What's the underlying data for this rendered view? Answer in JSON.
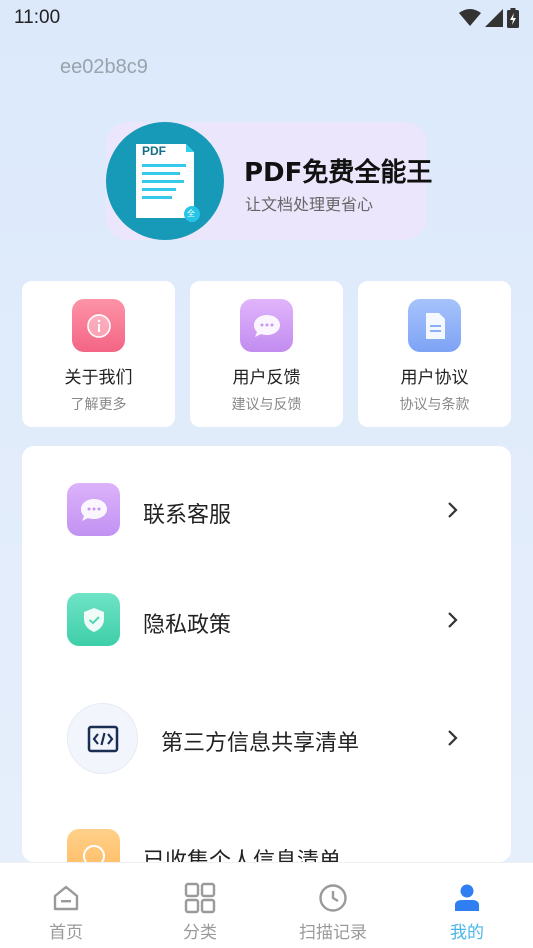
{
  "status_bar": {
    "time": "11:00"
  },
  "user": {
    "id": "ee02b8c9"
  },
  "app": {
    "name": "PDF免费全能王",
    "slogan": "让文档处理更省心",
    "logo_text": "PDF",
    "logo_badge": "全"
  },
  "quick_links": [
    {
      "title": "关于我们",
      "subtitle": "了解更多",
      "icon": "info-icon",
      "color": "#f7768f"
    },
    {
      "title": "用户反馈",
      "subtitle": "建议与反馈",
      "icon": "chat-bubble-icon",
      "color": "#cf98f3"
    },
    {
      "title": "用户协议",
      "subtitle": "协议与条款",
      "icon": "document-icon",
      "color": "#8aaef8"
    }
  ],
  "menu": [
    {
      "label": "联系客服",
      "icon": "chat-bubble-icon",
      "color": "#c89cf5"
    },
    {
      "label": "隐私政策",
      "icon": "shield-check-icon",
      "color": "#4fd6b4"
    },
    {
      "label": "第三方信息共享清单",
      "icon": "code-icon",
      "color": "#f3f5fa"
    },
    {
      "label": "已收集个人信息清单",
      "icon": "list-icon",
      "color": "#ffc77a"
    }
  ],
  "tabs": [
    {
      "label": "首页",
      "icon": "home-icon",
      "active": false
    },
    {
      "label": "分类",
      "icon": "grid-icon",
      "active": false
    },
    {
      "label": "扫描记录",
      "icon": "clock-icon",
      "active": false
    },
    {
      "label": "我的",
      "icon": "user-icon",
      "active": true
    }
  ],
  "colors": {
    "accent": "#49b6e8",
    "logo": "#1799b8",
    "banner": "#ebe6fb"
  }
}
